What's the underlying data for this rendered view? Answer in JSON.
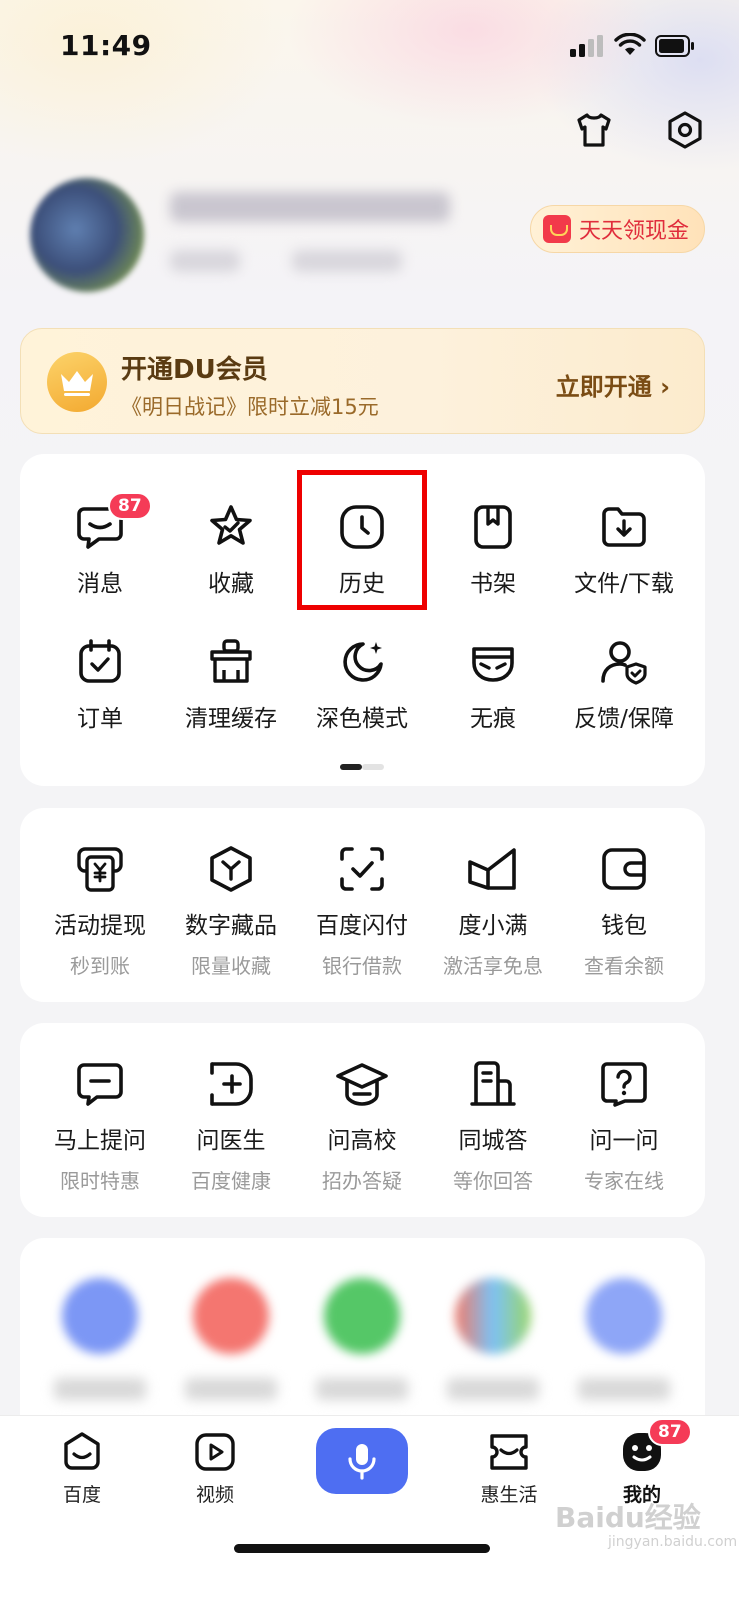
{
  "status_bar": {
    "time": "11:49"
  },
  "profile": {
    "cash_button_label": "天天领现金"
  },
  "vip_banner": {
    "title": "开通DU会员",
    "subtitle": "《明日战记》限时立减15元",
    "action_label": "立即开通 ›"
  },
  "tools": {
    "row1": [
      {
        "label": "消息",
        "icon": "message-icon",
        "badge": "87"
      },
      {
        "label": "收藏",
        "icon": "star-icon"
      },
      {
        "label": "历史",
        "icon": "clock-icon"
      },
      {
        "label": "书架",
        "icon": "bookshelf-icon"
      },
      {
        "label": "文件/下载",
        "icon": "folder-download-icon"
      }
    ],
    "row2": [
      {
        "label": "订单",
        "icon": "calendar-check-icon"
      },
      {
        "label": "清理缓存",
        "icon": "broom-icon"
      },
      {
        "label": "深色模式",
        "icon": "moon-icon"
      },
      {
        "label": "无痕",
        "icon": "mask-icon"
      },
      {
        "label": "反馈/保障",
        "icon": "user-shield-icon"
      }
    ]
  },
  "finance": [
    {
      "label": "活动提现",
      "sub": "秒到账",
      "icon": "yuan-card-icon"
    },
    {
      "label": "数字藏品",
      "sub": "限量收藏",
      "icon": "cube-icon"
    },
    {
      "label": "百度闪付",
      "sub": "银行借款",
      "icon": "scan-check-icon"
    },
    {
      "label": "度小满",
      "sub": "激活享免息",
      "icon": "duxiaoman-icon"
    },
    {
      "label": "钱包",
      "sub": "查看余额",
      "icon": "wallet-icon"
    }
  ],
  "ask": [
    {
      "label": "马上提问",
      "sub": "限时特惠",
      "icon": "ask-bubble-icon"
    },
    {
      "label": "问医生",
      "sub": "百度健康",
      "icon": "doctor-icon"
    },
    {
      "label": "问高校",
      "sub": "招办答疑",
      "icon": "graduation-cap-icon"
    },
    {
      "label": "同城答",
      "sub": "等你回答",
      "icon": "building-icon"
    },
    {
      "label": "问一问",
      "sub": "专家在线",
      "icon": "question-icon"
    }
  ],
  "tab_bar": {
    "tabs": [
      {
        "label": "百度",
        "icon": "baidu-face-icon"
      },
      {
        "label": "视频",
        "icon": "video-play-icon"
      },
      {
        "label": "惠生活",
        "icon": "ticket-face-icon"
      },
      {
        "label": "我的",
        "icon": "me-face-icon",
        "badge": "87"
      }
    ],
    "mic_icon": "microphone-icon"
  },
  "watermark": {
    "text": "Baidu经验",
    "sub": "jingyan.baidu.com"
  },
  "colors": {
    "accent": "#4e6ef2",
    "badge": "#f53b57",
    "highlight": "#ee0000",
    "vip_text": "#7a4c14"
  }
}
